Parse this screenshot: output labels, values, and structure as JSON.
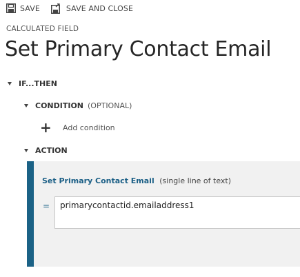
{
  "toolbar": {
    "save_label": "SAVE",
    "save_icon": "floppy-disk-icon",
    "save_close_label": "SAVE AND CLOSE",
    "save_close_icon": "save-and-close-icon"
  },
  "header": {
    "entity_label": "CALCULATED FIELD",
    "title": "Set Primary Contact Email"
  },
  "sections": {
    "if_then": "IF...THEN",
    "condition": "CONDITION",
    "condition_optional": "(OPTIONAL)",
    "add_condition": "Add condition",
    "action": "ACTION"
  },
  "action_card": {
    "field_name": "Set Primary Contact Email",
    "field_type": "(single line of text)",
    "equals": "=",
    "formula": "primarycontactid.emailaddress1"
  },
  "colors": {
    "accent": "#1b6286",
    "card_background": "#f1f1f1"
  }
}
